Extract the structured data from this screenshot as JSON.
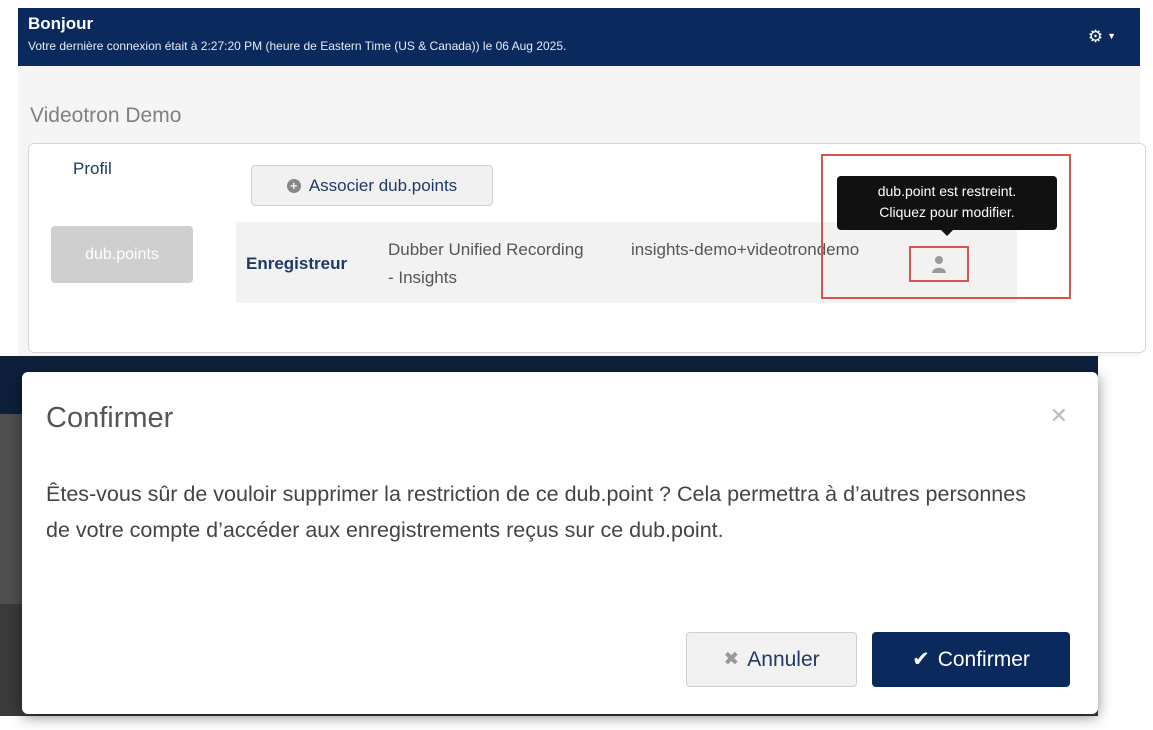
{
  "header": {
    "greeting": "Bonjour",
    "last_login": "Votre dernière connexion était à 2:27:20 PM (heure de Eastern Time (US & Canada)) le 06 Aug 2025.",
    "settings_icon": "gear-icon"
  },
  "account": {
    "name": "Videotron Demo"
  },
  "nav": {
    "profil": "Profil",
    "dubpoints": "dub.points"
  },
  "toolbar": {
    "associate_label": "Associer dub.points",
    "associate_icon": "plus-circle-icon"
  },
  "dubpoint_row": {
    "type": "Enregistreur",
    "name": "Dubber Unified Recording - Insights",
    "user": "insights-demo+videotrondemo",
    "restriction_icon": "user-icon"
  },
  "tooltip": {
    "line1": "dub.point est restreint.",
    "line2": "Cliquez pour modifier."
  },
  "modal": {
    "title": "Confirmer",
    "body": "Êtes-vous sûr de vouloir supprimer la restriction de ce dub.point ? Cela permettra à d’autres personnes de votre compte d’accéder aux enregistrements reçus sur ce dub.point.",
    "cancel_label": "Annuler",
    "confirm_label": "Confirmer"
  },
  "colors": {
    "header_bg": "#0a2a5e",
    "link": "#1f3a68",
    "highlight": "#d9534f"
  }
}
